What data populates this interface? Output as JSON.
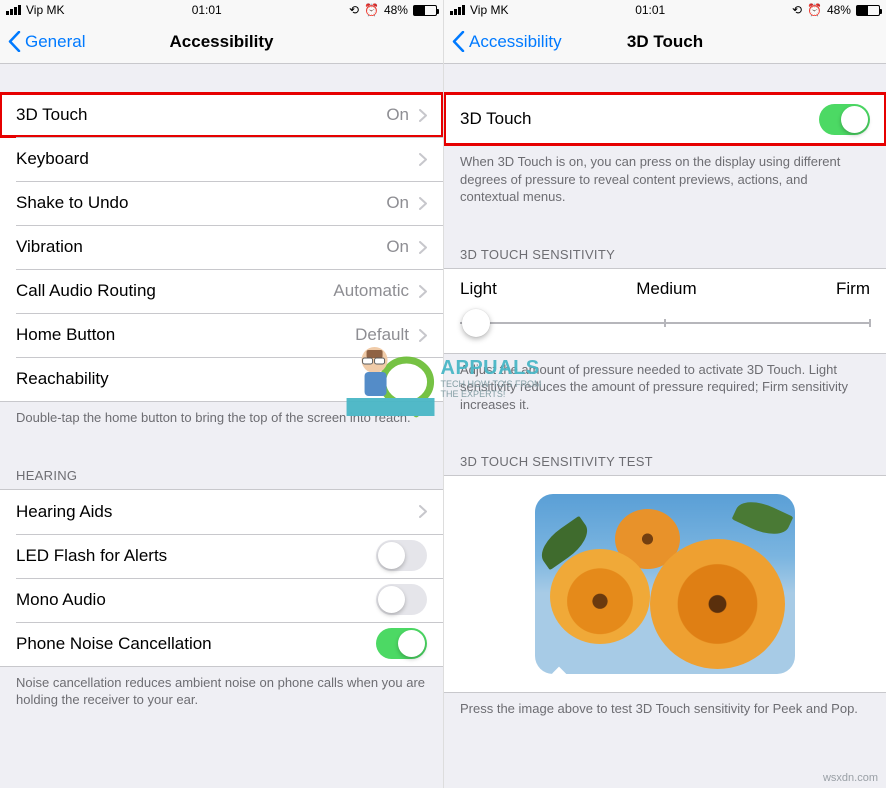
{
  "statusBar": {
    "carrier": "Vip MK",
    "time": "01:01",
    "battery": "48%"
  },
  "left": {
    "back": "General",
    "title": "Accessibility",
    "rows": {
      "touch3d": {
        "label": "3D Touch",
        "value": "On"
      },
      "keyboard": {
        "label": "Keyboard"
      },
      "shake": {
        "label": "Shake to Undo",
        "value": "On"
      },
      "vibration": {
        "label": "Vibration",
        "value": "On"
      },
      "callAudio": {
        "label": "Call Audio Routing",
        "value": "Automatic"
      },
      "homeButton": {
        "label": "Home Button",
        "value": "Default"
      },
      "reachability": {
        "label": "Reachability"
      }
    },
    "reachFooter": "Double-tap the home button to bring the top of the screen into reach.",
    "hearingHeader": "HEARING",
    "hearing": {
      "aids": {
        "label": "Hearing Aids"
      },
      "led": {
        "label": "LED Flash for Alerts",
        "on": false
      },
      "mono": {
        "label": "Mono Audio",
        "on": false
      },
      "noise": {
        "label": "Phone Noise Cancellation",
        "on": true
      }
    },
    "noiseFooter": "Noise cancellation reduces ambient noise on phone calls when you are holding the receiver to your ear."
  },
  "right": {
    "back": "Accessibility",
    "title": "3D Touch",
    "toggle": {
      "label": "3D Touch",
      "on": true
    },
    "toggleFooter": "When 3D Touch is on, you can press on the display using different degrees of pressure to reveal content previews, actions, and contextual menus.",
    "sensHeader": "3D TOUCH SENSITIVITY",
    "sens": {
      "light": "Light",
      "medium": "Medium",
      "firm": "Firm"
    },
    "sensFooter": "Adjust the amount of pressure needed to activate 3D Touch. Light sensitivity reduces the amount of pressure required; Firm sensitivity increases it.",
    "testHeader": "3D TOUCH SENSITIVITY TEST",
    "testFooter": "Press the image above to test 3D Touch sensitivity for Peek and Pop."
  },
  "watermark": {
    "title": "APPUALS",
    "sub1": "TECH HOW-TO'S FROM",
    "sub2": "THE EXPERTS!",
    "corner": "wsxdn.com"
  }
}
